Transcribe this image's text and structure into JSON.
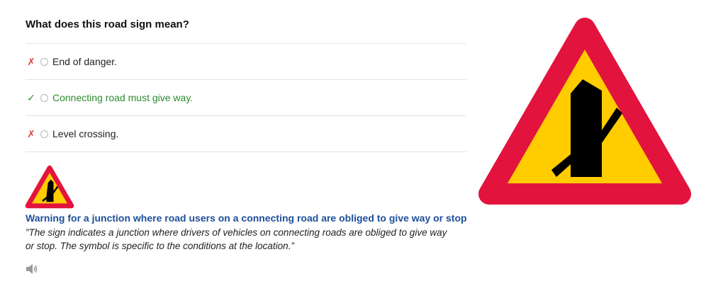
{
  "question": {
    "text": "What does this road sign mean?"
  },
  "answers": [
    {
      "mark": "✗",
      "status": "wrong",
      "label": "End of danger."
    },
    {
      "mark": "✓",
      "status": "correct",
      "label": "Connecting road must give way."
    },
    {
      "mark": "✗",
      "status": "wrong",
      "label": "Level crossing."
    }
  ],
  "explanation": {
    "title": "Warning for a junction where road users on a connecting road are obliged to give way or stop",
    "text": "”The sign indicates a junction where drivers of vehicles on connecting roads are obliged to give way or stop. The symbol is specific to the conditions at the location.”"
  },
  "icons": {
    "audio": "speaker-icon",
    "sign": "junction-warning-sign"
  },
  "colors": {
    "sign_border": "#e2143e",
    "sign_fill": "#ffcc00",
    "symbol": "#000000",
    "title_blue": "#1d4f9a",
    "correct_green": "#2e8a2e",
    "wrong_red": "#e0443a"
  }
}
